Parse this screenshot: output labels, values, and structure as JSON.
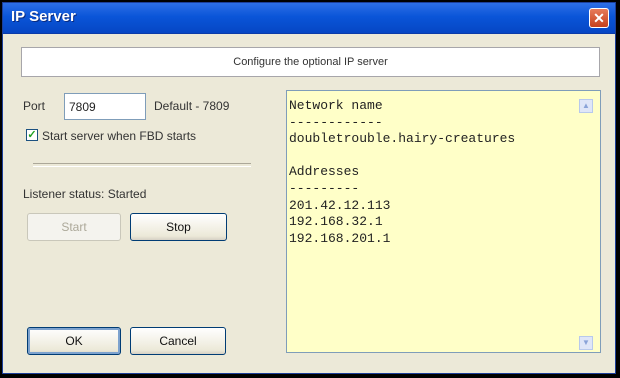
{
  "window": {
    "title": "IP Server",
    "close_glyph": "✕"
  },
  "banner": {
    "text": "Configure the optional IP server"
  },
  "port": {
    "label": "Port",
    "value": "7809",
    "default_text": "Default - 7809"
  },
  "start_checkbox": {
    "checked": true,
    "check_glyph": "✓",
    "label": "Start server when FBD starts"
  },
  "listener": {
    "status_text": "Listener status: Started"
  },
  "buttons": {
    "start": "Start",
    "stop": "Stop",
    "ok": "OK",
    "cancel": "Cancel"
  },
  "info": {
    "network_heading": "Network name",
    "network_rule": "------------",
    "network_name": "doubletrouble.hairy-creatures",
    "addresses_heading": "Addresses",
    "addresses_rule": "---------",
    "addresses": [
      "201.42.12.113",
      "192.168.32.1",
      "192.168.201.1"
    ]
  },
  "scrollbar": {
    "up_glyph": "▲",
    "down_glyph": "▼"
  }
}
